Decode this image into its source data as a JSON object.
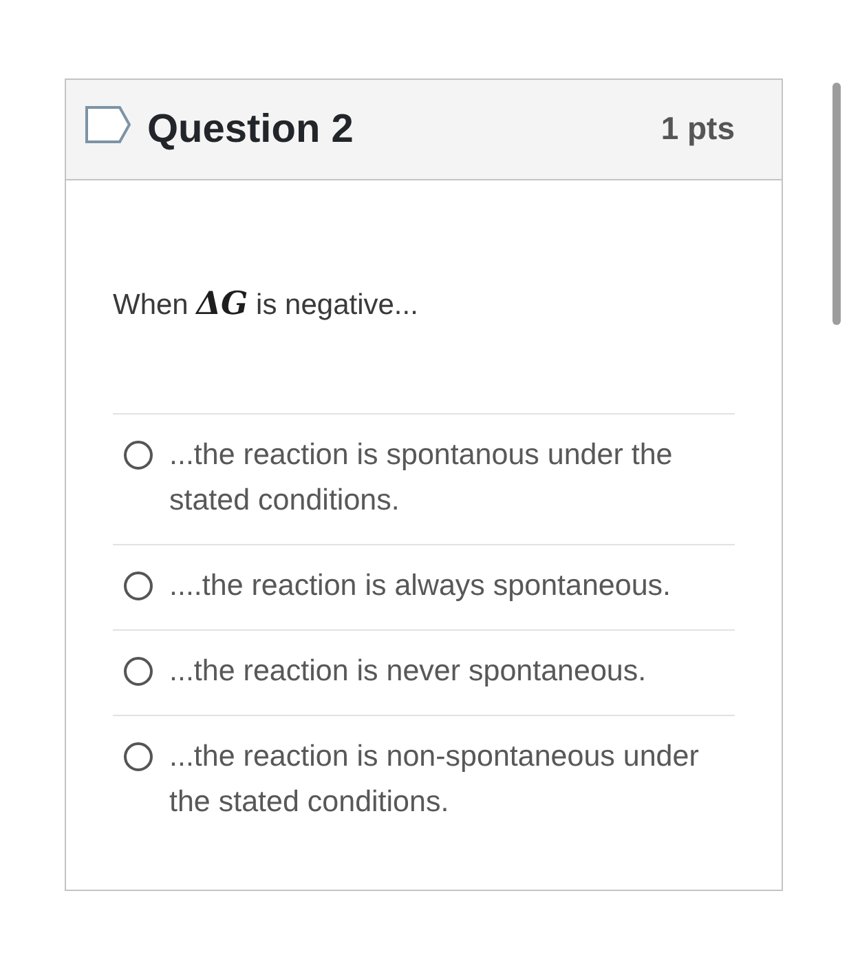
{
  "question": {
    "title": "Question 2",
    "points": "1 pts",
    "flagged": false,
    "text": "When *ΔG* is negative...",
    "options": [
      {
        "label": "...the reaction is spontanous under the stated conditions.",
        "selected": false
      },
      {
        "label": "....the reaction is always spontaneous.",
        "selected": false
      },
      {
        "label": "...the reaction is never spontaneous.",
        "selected": false
      },
      {
        "label": "...the reaction is non-spontaneous under the stated conditions.",
        "selected": false
      }
    ]
  }
}
